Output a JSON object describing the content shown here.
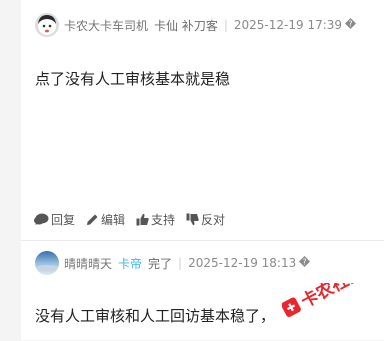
{
  "thread": {
    "post1": {
      "username": "卡农大卡车司机",
      "badge": "卡仙 补刀客",
      "timestamp": "2025-12-19 17:39",
      "more_icon": "more-icon",
      "body": "点了没有人工审核基本就是稳",
      "actions": {
        "reply": "回复",
        "edit": "编辑",
        "like": "支持",
        "dislike": "反对"
      }
    },
    "post2": {
      "username": "晴晴晴天",
      "badge_level": "卡帝",
      "badge_rest": "完了",
      "badge_level_color": "#3fb9e0",
      "timestamp": "2025-12-19 18:13",
      "more_icon": "more-icon",
      "body": "没有人工审核和人工回访基本稳了，"
    }
  },
  "watermark": {
    "text": "卡农社区",
    "color": "#e8262c"
  }
}
